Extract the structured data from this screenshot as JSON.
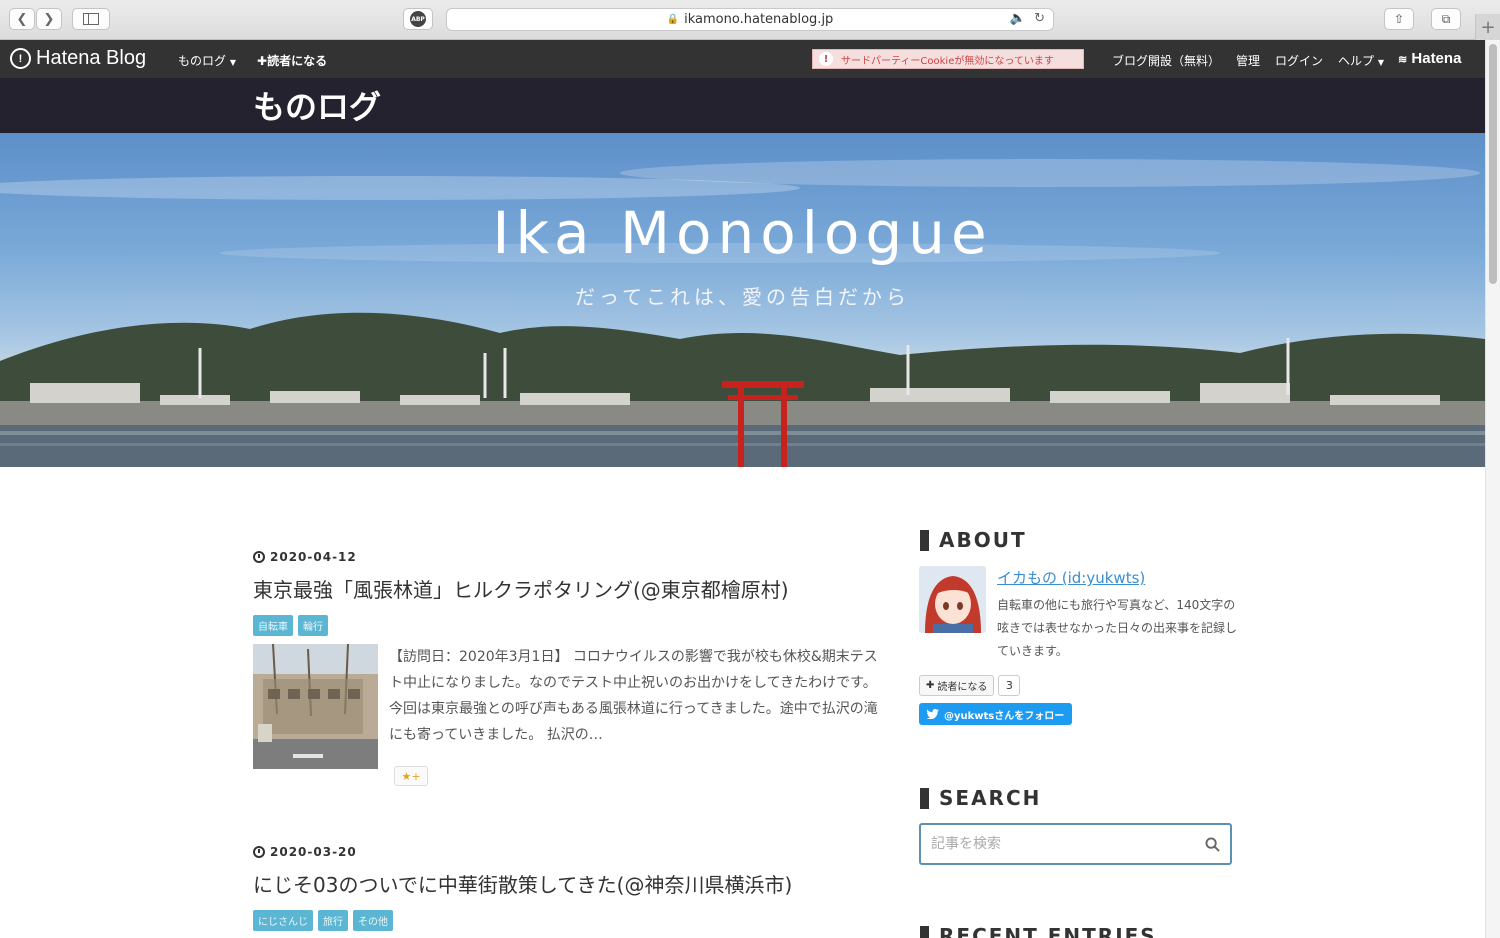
{
  "browser": {
    "url": "ikamono.hatenablog.jp",
    "abp": "ABP"
  },
  "hatena_bar": {
    "logo": "Hatena Blog",
    "blog_menu": "ものログ",
    "subscribe": "読者になる",
    "cookie_warning": "サードパーティーCookieが無効になっています",
    "start_blog": "ブログ開設（無料）",
    "admin": "管理",
    "login": "ログイン",
    "help": "ヘルプ",
    "hatena": "Hatena"
  },
  "blog": {
    "title": "ものログ",
    "hero_title": "Ika Monologue",
    "hero_subtitle": "だってこれは、愛の告白だから"
  },
  "articles": [
    {
      "date": "2020-04-12",
      "title": "東京最強「風張林道」ヒルクラポタリング(@東京都檜原村)",
      "tags": [
        "自転車",
        "輪行"
      ],
      "excerpt": "【訪問日：2020年3月1日】 コロナウイルスの影響で我が校も休校&期末テスト中止になりました。なのでテスト中止祝いのお出かけをしてきたわけです。 今回は東京最強との呼び声もある風張林道に行ってきました。途中で払沢の滝にも寄っていきました。 払沢の…",
      "star": "★+"
    },
    {
      "date": "2020-03-20",
      "title": "にじそ03のついでに中華街散策してきた(@神奈川県横浜市)",
      "tags": [
        "にじさんじ",
        "旅行",
        "その他"
      ]
    }
  ],
  "sidebar": {
    "about_heading": "ABOUT",
    "author_name": "イカもの (id:yukwts)",
    "author_desc": "自転車の他にも旅行や写真など、140文字の呟きでは表せなかった日々の出来事を記録していきます。",
    "subscribe_label": "読者になる",
    "subscribe_count": "3",
    "twitter_follow": "@yukwtsさんをフォロー",
    "search_heading": "SEARCH",
    "search_placeholder": "記事を検索",
    "recent_heading": "RECENT ENTRIES"
  },
  "colors": {
    "header_bar": "#333333",
    "title_band": "#24222f",
    "tag": "#5bb6d4",
    "link": "#3a8ed0",
    "search_border": "#5b8fb3"
  }
}
